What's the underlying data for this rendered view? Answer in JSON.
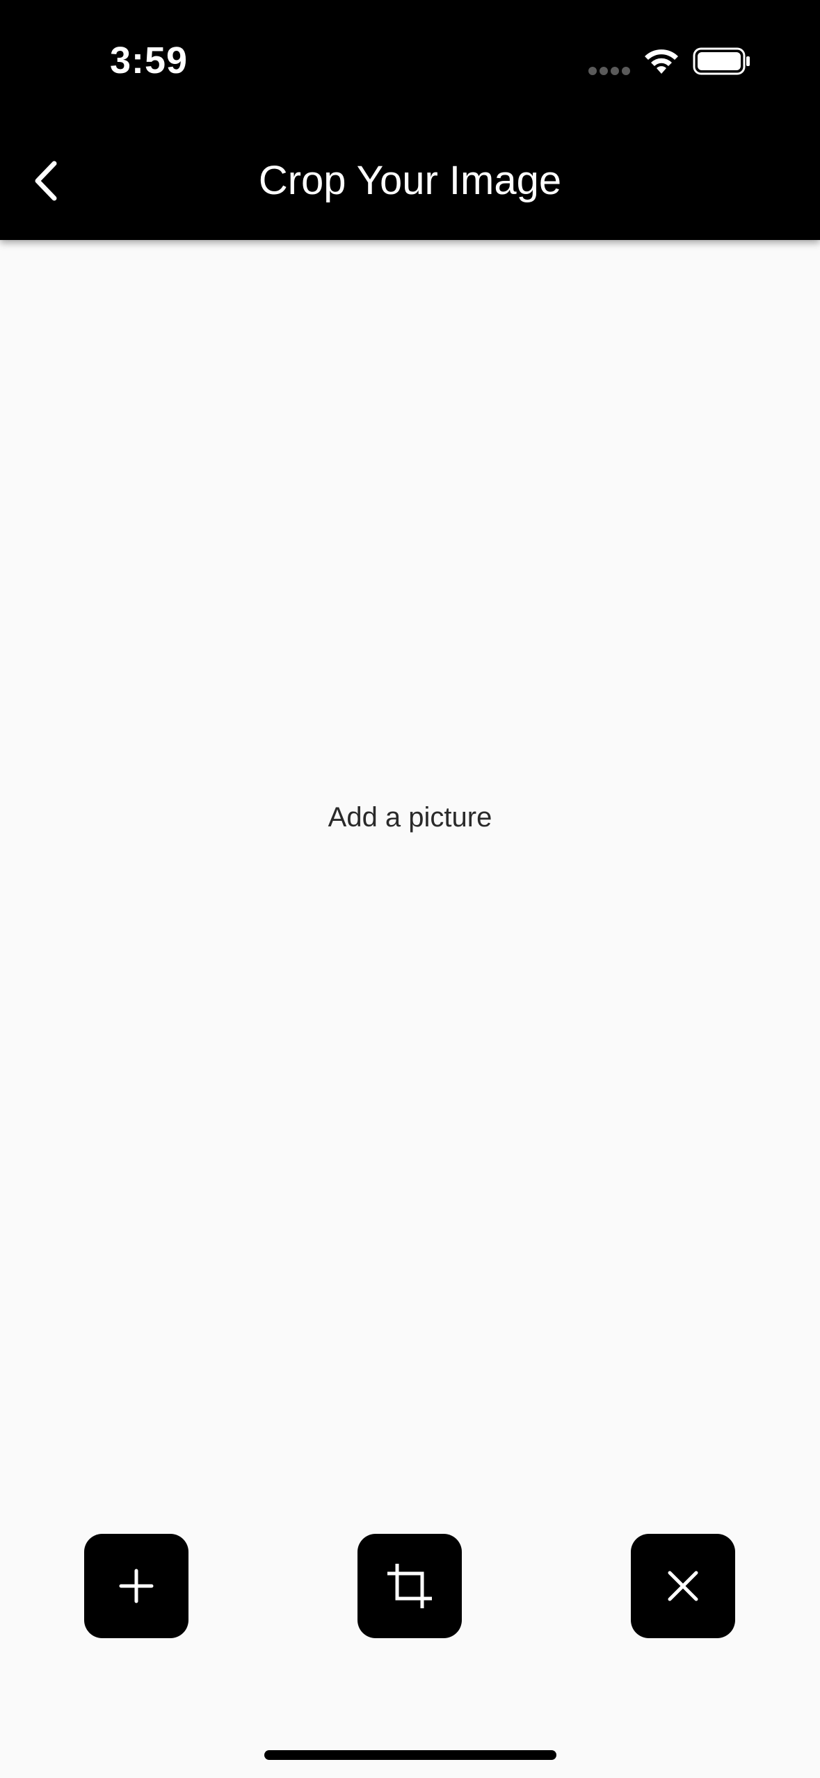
{
  "status_bar": {
    "time": "3:59",
    "icons": [
      "signal-dots-icon",
      "wifi-icon",
      "battery-icon"
    ]
  },
  "app_bar": {
    "title": "Crop Your Image",
    "back_icon": "chevron-left-icon"
  },
  "main": {
    "placeholder": "Add a picture"
  },
  "actions": [
    {
      "name": "add-picture-button",
      "icon": "plus-icon"
    },
    {
      "name": "crop-button",
      "icon": "crop-icon"
    },
    {
      "name": "clear-button",
      "icon": "close-icon"
    }
  ],
  "colors": {
    "header_bg": "#000000",
    "page_bg": "#fafafa",
    "button_bg": "#000000",
    "icon_fg": "#ffffff",
    "text_dark": "#2a2a2a"
  }
}
